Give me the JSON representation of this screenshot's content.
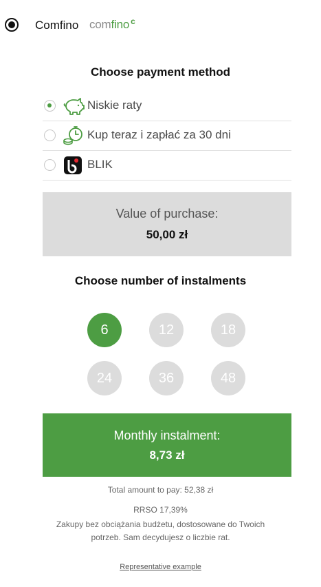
{
  "header": {
    "provider_name": "Comfino",
    "logo_part1": "com",
    "logo_part2": "fino",
    "logo_mark": "c"
  },
  "payment": {
    "title": "Choose payment method",
    "methods": [
      {
        "label": "Niskie raty",
        "icon": "piggy-bank-icon",
        "selected": true
      },
      {
        "label": "Kup teraz i zapłać za 30 dni",
        "icon": "coins-clock-icon",
        "selected": false
      },
      {
        "label": "BLIK",
        "icon": "blik-logo-icon",
        "selected": false
      }
    ]
  },
  "purchase": {
    "label": "Value of purchase:",
    "value": "50,00 zł"
  },
  "instalments": {
    "title": "Choose number of instalments",
    "options": [
      "6",
      "12",
      "18",
      "24",
      "36",
      "48"
    ],
    "selected": "6"
  },
  "monthly": {
    "label": "Monthly instalment:",
    "value": "8,73 zł"
  },
  "footer": {
    "total": "Total amount to pay: 52,38 zł",
    "rrso": "RRSO 17,39%",
    "description": "Zakupy bez obciążania budżetu, dostosowane do Twoich potrzeb. Sam decydujesz o liczbie rat.",
    "representative_link": "Representative example"
  },
  "colors": {
    "accent": "#4d9d43",
    "grey_box": "#dcdcdc",
    "inactive_circle": "#dcdcdc"
  }
}
